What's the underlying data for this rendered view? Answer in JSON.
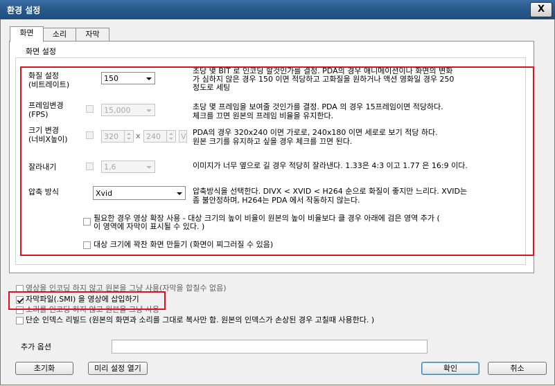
{
  "window": {
    "title": "환경 설정",
    "close": "X"
  },
  "tabs": [
    "화면",
    "소리",
    "자막"
  ],
  "screen": {
    "group_title": "화면 설정",
    "quality": {
      "label1": "화질 설정",
      "label2": "(비트레이트)",
      "value": "150",
      "desc1": "초당 몇 BIT 로 인코딩 할것인가를 결정. PDA의 경우 애니메이션이나 화면의 변화",
      "desc2": "가 심하지 않은 경우 150 이면 적당하고 고화질을 원하거나 액션 영화일 경우  250",
      "desc3": "정도로 세팅"
    },
    "fps": {
      "label1": "프레임변경",
      "label2": "(FPS)",
      "value": "15,000",
      "desc1": "초당 몇 프레임을 보여줄 것인가를 결정. PDA 의 경우 15프레임이면 적당하다.",
      "desc2": "체크를 끄면 원본의 프레임 비율을 유지한다."
    },
    "size": {
      "label1": "크기 변경",
      "label2": "(너비X높이)",
      "width": "320",
      "x_sep": "x",
      "height": "240",
      "unit": "V",
      "desc1": "PDA의 경우 320x240 이면 가로로, 240x180 이면 세로로 보기 적당 하다.",
      "desc2": "원본 크기를 유지하고 싶을 경우 체크를 끄면 된다."
    },
    "crop": {
      "label": "잘라내기",
      "value": "1,6",
      "desc": "이미지가 너무 옆으로 길 경우 적당히 잘라낸다. 1.33은 4:3 이고 1.77 은 16:9 이다."
    },
    "codec": {
      "label": "압축 방식",
      "value": "Xvid",
      "desc1": "압축방식을 선택한다.  DIVX < XVID < H264 순으로 화질이 좋지만 느리다.  XVID는",
      "desc2": "좀 불안정하며,  H264는 PDA 에서 작동하지 않는다."
    },
    "expand": {
      "line1": "필요한 경우 영상 확장 사용 - 대상 크기의 높이 비율이 원본의 높이 비율보다 클 경우 아래에 검은  영역 추가 (",
      "line2": "이 영역에 자막이 표시될 수 있다. )"
    },
    "fill": {
      "label": "대상 크기에 꽉찬 화면 만들기 (화면이 찌그러질 수 있음)"
    }
  },
  "options": {
    "no_encode_video": "영상을 인코딩 하지 않고 원본을 그냥 사용(자막을 합칠수 없음)",
    "insert_subtitle": "자막파일(.SMI) 을 영상에 삽입하기",
    "no_encode_audio": "소리를 인코딩 하지 않고 원본을 그냥 사용",
    "rebuild_index": "단순 인덱스 리빌드 (원본의 화면과 소리를 그대로 복사만 함. 원본의 인덱스가 손상된 경우 고칠때 사용한다. )"
  },
  "extra": {
    "label": "추가 옵션",
    "value": ""
  },
  "buttons": {
    "reset": "초기화",
    "preset": "미리 설정 열기",
    "ok": "확인",
    "cancel": "취소"
  },
  "colors": {
    "highlight": "#e01020",
    "title_bar": "#2a5a8e"
  }
}
